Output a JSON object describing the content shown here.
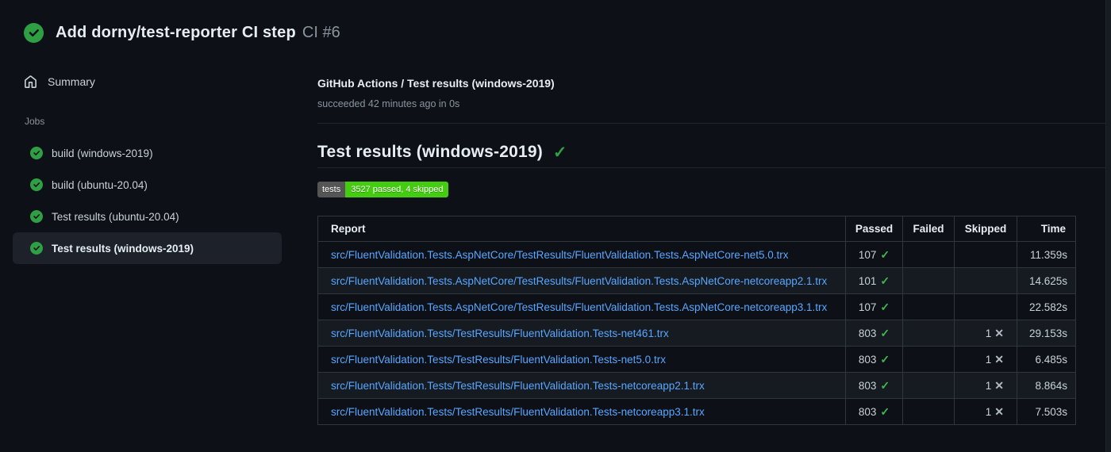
{
  "colors": {
    "background": "#0d1117",
    "panel_alt_row": "#161b22",
    "border_subtle": "#21262d",
    "table_border": "#30363d",
    "text_primary": "#c9d1d9",
    "text_bold": "#e6edf3",
    "text_secondary": "#8b949e",
    "success_green": "#2ea043",
    "check_green": "#3fb950",
    "link_blue": "#58a6ff",
    "badge_label_bg": "#555555",
    "badge_value_bg": "#44cc11"
  },
  "icons": {
    "run_status": "check-circle-icon",
    "summary": "home-icon",
    "job_status": "check-circle-icon",
    "heading_check_glyph": "✓",
    "pass_check_glyph": "✓",
    "skip_x_glyph": "✕"
  },
  "run_header": {
    "title": "Add dorny/test-reporter CI step",
    "run_number": "CI #6"
  },
  "sidebar": {
    "summary_label": "Summary",
    "jobs_label": "Jobs",
    "jobs": [
      {
        "label": "build (windows-2019)",
        "status": "success",
        "selected": false
      },
      {
        "label": "build (ubuntu-20.04)",
        "status": "success",
        "selected": false
      },
      {
        "label": "Test results (ubuntu-20.04)",
        "status": "success",
        "selected": false
      },
      {
        "label": "Test results (windows-2019)",
        "status": "success",
        "selected": true
      }
    ]
  },
  "job_panel": {
    "title": "GitHub Actions / Test results (windows-2019)",
    "status_line": "succeeded 42 minutes ago in 0s",
    "section_heading": "Test results (windows-2019)",
    "badge": {
      "label": "tests",
      "value": "3527 passed, 4 skipped"
    },
    "table": {
      "columns": [
        "Report",
        "Passed",
        "Failed",
        "Skipped",
        "Time"
      ],
      "rows": [
        {
          "report": "src/FluentValidation.Tests.AspNetCore/TestResults/FluentValidation.Tests.AspNetCore-net5.0.trx",
          "passed": "107",
          "failed": "",
          "skipped": "",
          "time": "11.359s"
        },
        {
          "report": "src/FluentValidation.Tests.AspNetCore/TestResults/FluentValidation.Tests.AspNetCore-netcoreapp2.1.trx",
          "passed": "101",
          "failed": "",
          "skipped": "",
          "time": "14.625s"
        },
        {
          "report": "src/FluentValidation.Tests.AspNetCore/TestResults/FluentValidation.Tests.AspNetCore-netcoreapp3.1.trx",
          "passed": "107",
          "failed": "",
          "skipped": "",
          "time": "22.582s"
        },
        {
          "report": "src/FluentValidation.Tests/TestResults/FluentValidation.Tests-net461.trx",
          "passed": "803",
          "failed": "",
          "skipped": "1",
          "time": "29.153s"
        },
        {
          "report": "src/FluentValidation.Tests/TestResults/FluentValidation.Tests-net5.0.trx",
          "passed": "803",
          "failed": "",
          "skipped": "1",
          "time": "6.485s"
        },
        {
          "report": "src/FluentValidation.Tests/TestResults/FluentValidation.Tests-netcoreapp2.1.trx",
          "passed": "803",
          "failed": "",
          "skipped": "1",
          "time": "8.864s"
        },
        {
          "report": "src/FluentValidation.Tests/TestResults/FluentValidation.Tests-netcoreapp3.1.trx",
          "passed": "803",
          "failed": "",
          "skipped": "1",
          "time": "7.503s"
        }
      ]
    }
  }
}
